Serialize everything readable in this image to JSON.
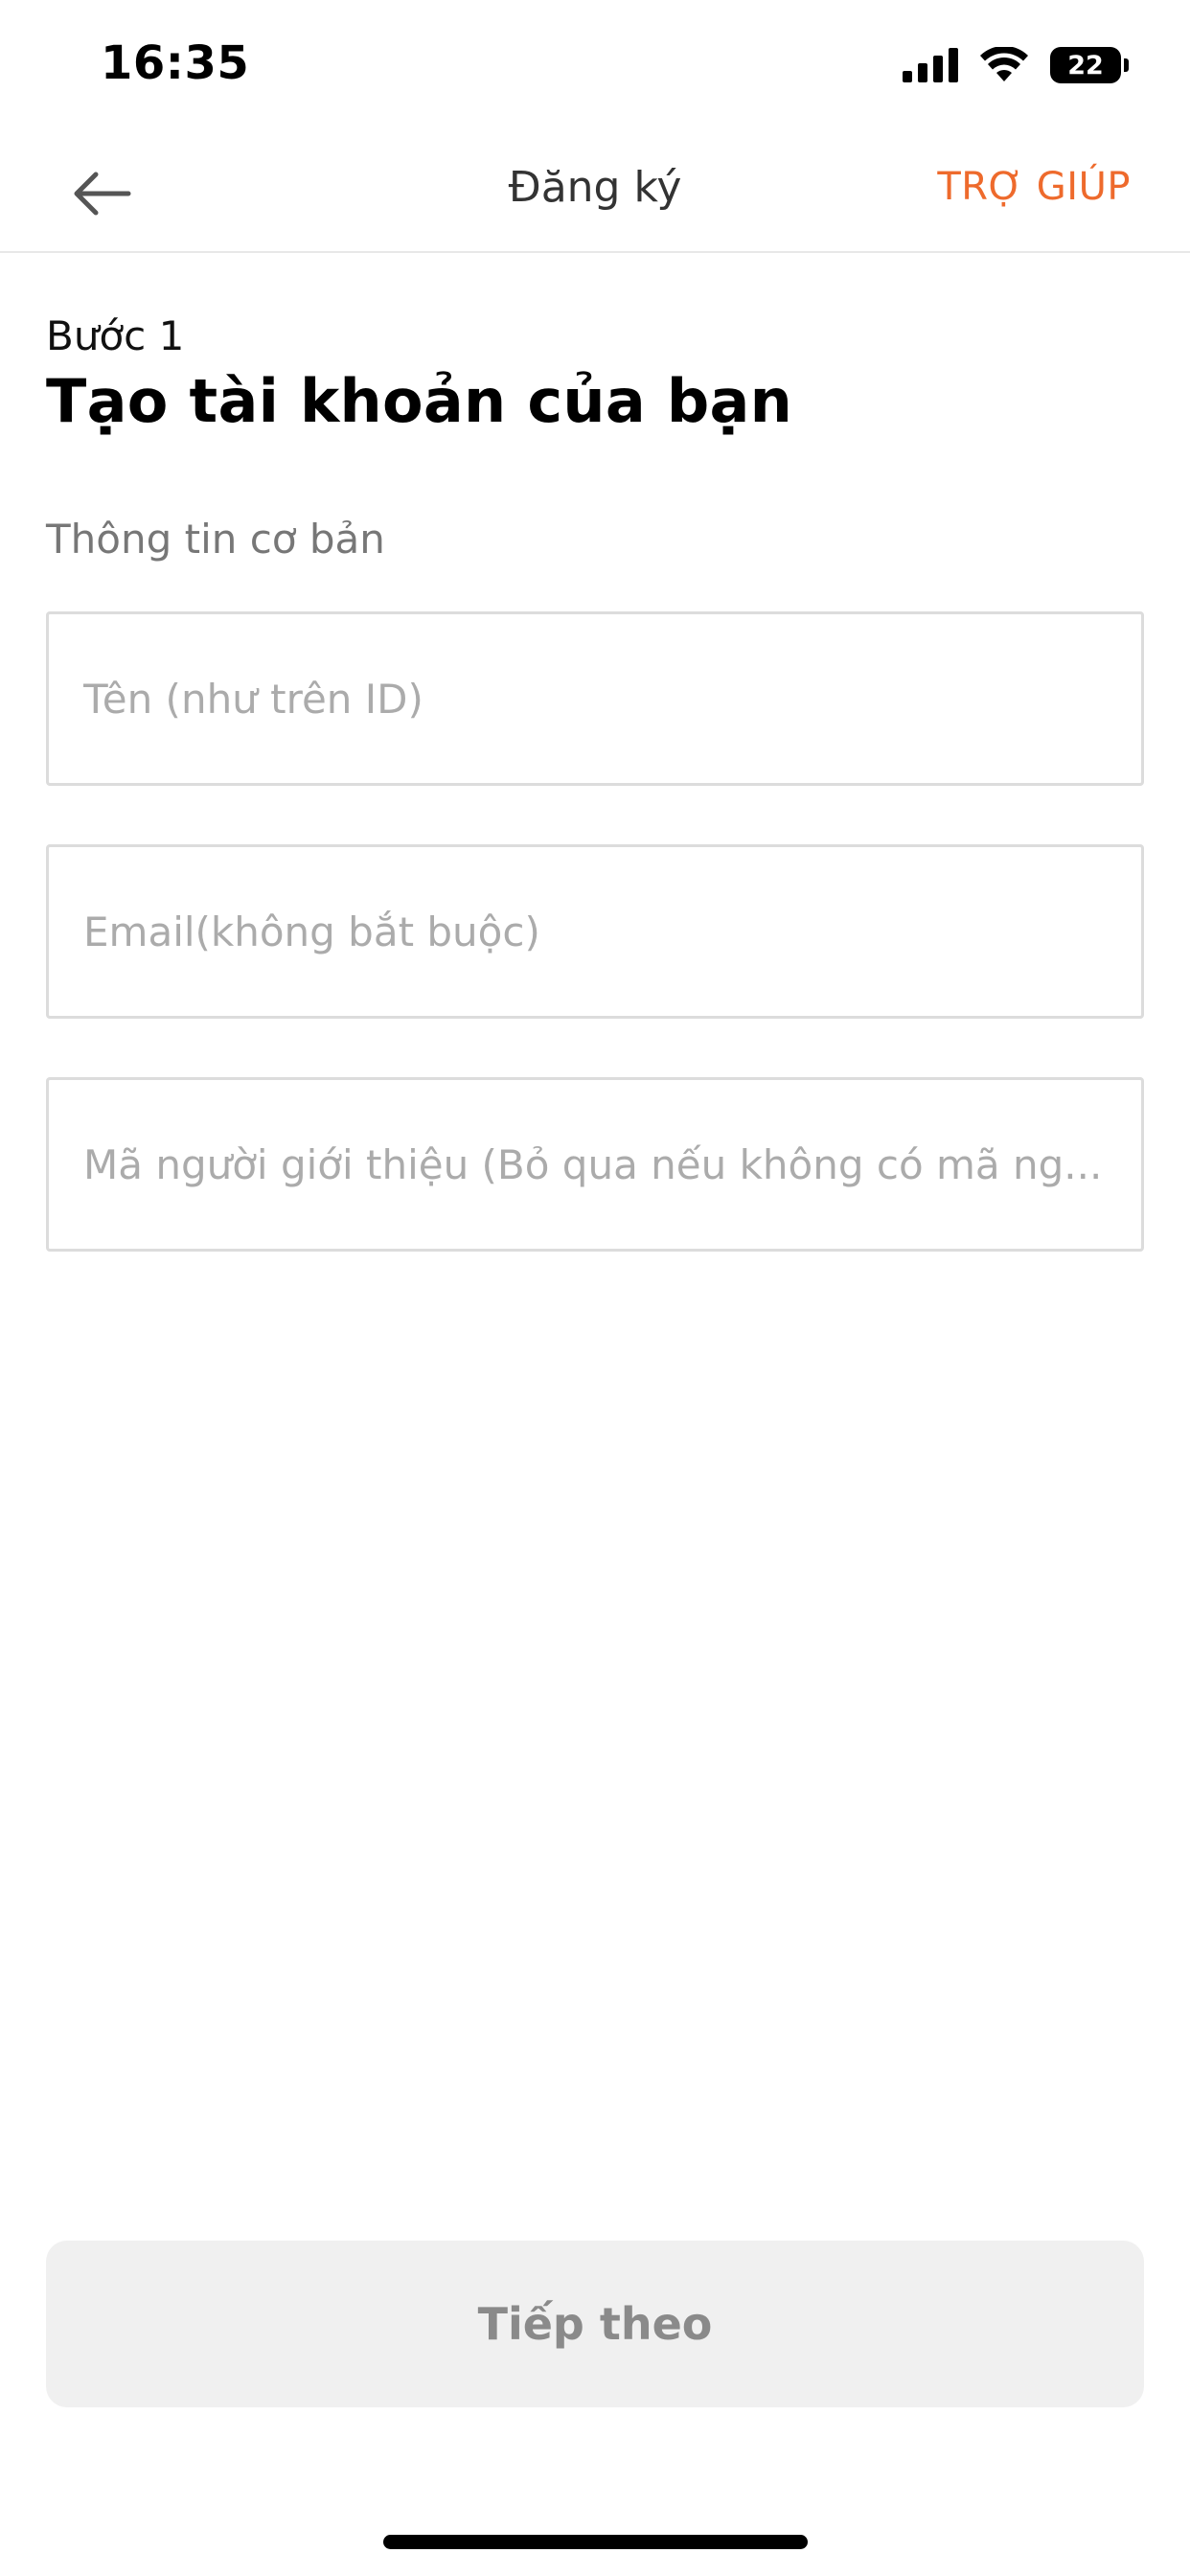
{
  "status_bar": {
    "time": "16:35",
    "battery_level": "22",
    "icons": [
      "signal-icon",
      "wifi-icon",
      "battery-icon"
    ]
  },
  "nav": {
    "title": "Đăng ký",
    "help_label": "TRỢ GIÚP",
    "back_icon": "arrow-left-icon"
  },
  "heading": {
    "step": "Bước 1",
    "title": "Tạo tài khoản của bạn"
  },
  "form": {
    "section_label": "Thông tin cơ bản",
    "fields": [
      {
        "placeholder": "Tên (như trên ID)",
        "value": ""
      },
      {
        "placeholder": "Email(không bắt buộc)",
        "value": ""
      },
      {
        "placeholder": "Mã người giới thiệu (Bỏ qua nếu không có mã ng...",
        "value": ""
      }
    ]
  },
  "actions": {
    "next_label": "Tiếp theo"
  },
  "colors": {
    "accent": "#ee6a2c",
    "button_disabled_bg": "#f0f0f0",
    "button_disabled_text": "#8a8a8a",
    "placeholder": "#ababab",
    "border": "#dcdcdc"
  }
}
